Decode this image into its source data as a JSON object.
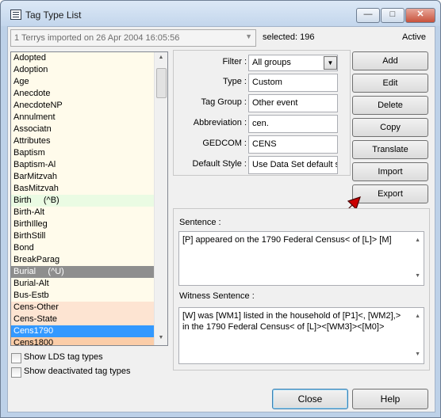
{
  "window": {
    "title": "Tag Type List"
  },
  "header": {
    "dataset": "1 Terrys imported on 26 Apr 2004 16:05:56",
    "selected": "selected: 196",
    "status": "Active"
  },
  "tag_list": {
    "items": [
      {
        "label": "Adopted",
        "bg": "#fffbeb",
        "fg": "#000000"
      },
      {
        "label": "Adoption",
        "bg": "#fffbeb",
        "fg": "#000000"
      },
      {
        "label": "Age",
        "bg": "#fffbeb",
        "fg": "#000000"
      },
      {
        "label": "Anecdote",
        "bg": "#fffbeb",
        "fg": "#000000"
      },
      {
        "label": "AnecdoteNP",
        "bg": "#fffbeb",
        "fg": "#000000"
      },
      {
        "label": "Annulment",
        "bg": "#fffbeb",
        "fg": "#000000"
      },
      {
        "label": "Associatn",
        "bg": "#fffbeb",
        "fg": "#000000"
      },
      {
        "label": "Attributes",
        "bg": "#fffbeb",
        "fg": "#000000"
      },
      {
        "label": "Baptism",
        "bg": "#fffbeb",
        "fg": "#000000"
      },
      {
        "label": "Baptism-Al",
        "bg": "#fffbeb",
        "fg": "#000000"
      },
      {
        "label": "BarMitzvah",
        "bg": "#fffbeb",
        "fg": "#000000"
      },
      {
        "label": "BasMitzvah",
        "bg": "#fffbeb",
        "fg": "#000000"
      },
      {
        "label": "Birth     (^B)",
        "bg": "#eafbe3",
        "fg": "#000000"
      },
      {
        "label": "Birth-Alt",
        "bg": "#fffbeb",
        "fg": "#000000"
      },
      {
        "label": "BirthIlleg",
        "bg": "#fffbeb",
        "fg": "#000000"
      },
      {
        "label": "BirthStill",
        "bg": "#fffbeb",
        "fg": "#000000"
      },
      {
        "label": "Bond",
        "bg": "#fffbeb",
        "fg": "#000000"
      },
      {
        "label": "BreakParag",
        "bg": "#fffbeb",
        "fg": "#000000"
      },
      {
        "label": "Burial     (^U)",
        "bg": "#8e8e8e",
        "fg": "#ffffff"
      },
      {
        "label": "Burial-Alt",
        "bg": "#fffbeb",
        "fg": "#000000"
      },
      {
        "label": "Bus-Estb",
        "bg": "#fffbeb",
        "fg": "#000000"
      },
      {
        "label": "Cens-Other",
        "bg": "#fde4d2",
        "fg": "#000000"
      },
      {
        "label": "Cens-State",
        "bg": "#fde4d2",
        "fg": "#000000"
      },
      {
        "label": "Cens1790",
        "bg": "#3399ff",
        "fg": "#ffffff"
      },
      {
        "label": "Cens1800",
        "bg": "#fbcda8",
        "fg": "#000000"
      }
    ]
  },
  "checkboxes": {
    "lds": "Show LDS tag types",
    "deactivated": "Show deactivated tag types"
  },
  "form": {
    "filter_label": "Filter :",
    "filter_value": "All groups",
    "type_label": "Type :",
    "type_value": "Custom",
    "group_label": "Tag Group :",
    "group_value": "Other event",
    "abbrev_label": "Abbreviation :",
    "abbrev_value": "cen.",
    "gedcom_label": "GEDCOM :",
    "gedcom_value": "CENS",
    "style_label": "Default Style :",
    "style_value": "Use Data Set default s"
  },
  "actions": {
    "add": "Add",
    "edit": "Edit",
    "delete": "Delete",
    "copy": "Copy",
    "translate": "Translate",
    "import": "Import",
    "export": "Export"
  },
  "sentence": {
    "label": "Sentence :",
    "text": "[P] appeared on the 1790 Federal Census< of [L]> [M]"
  },
  "witness": {
    "label": "Witness Sentence :",
    "text": "[W] was [WM1] listed in the household of [P1]<, [WM2],> in the 1790 Federal Census< of [L]><[WM3]><[M0]>"
  },
  "footer": {
    "close": "Close",
    "help": "Help"
  },
  "colors": {
    "selection": "#3399ff",
    "list_bg": "#fffbeb",
    "cursor": "#cc0000"
  },
  "icons": {
    "title": "list-window-icon",
    "dropdown": "chevron-down-icon",
    "cursor": "arrow-cursor-icon"
  }
}
